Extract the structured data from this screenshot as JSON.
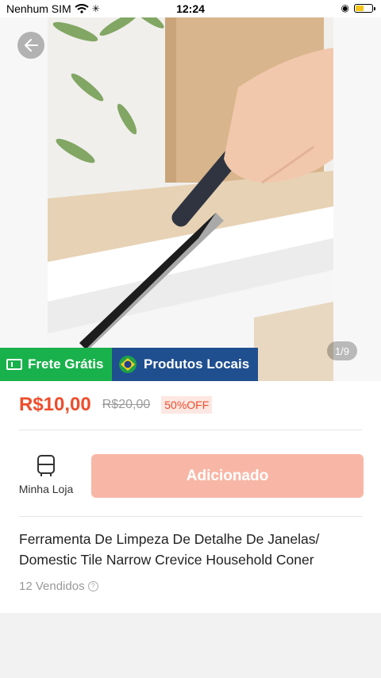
{
  "status_bar": {
    "carrier": "Nenhum SIM",
    "time": "12:24",
    "battery_level": 0.55
  },
  "gallery": {
    "counter": "1/9",
    "image_description_icon": "window-cleaning-brush-photo"
  },
  "badges": {
    "shipping": "Frete Grátis",
    "local": "Produtos Locais"
  },
  "product": {
    "price": "R$10,00",
    "original_price": "R$20,00",
    "discount": "50%OFF",
    "title_line1": "Ferramenta De Limpeza De Detalhe De Janelas/",
    "title_line2": "Domestic Tile Narrow Crevice Household Coner",
    "sold": "12 Vendidos"
  },
  "actions": {
    "store_label": "Minha Loja",
    "add_label": "Adicionado"
  },
  "colors": {
    "accent": "#ee4d2d",
    "green_badge": "#19b14b",
    "blue_badge": "#1f4f8f",
    "added_button": "#f8b7a6"
  }
}
